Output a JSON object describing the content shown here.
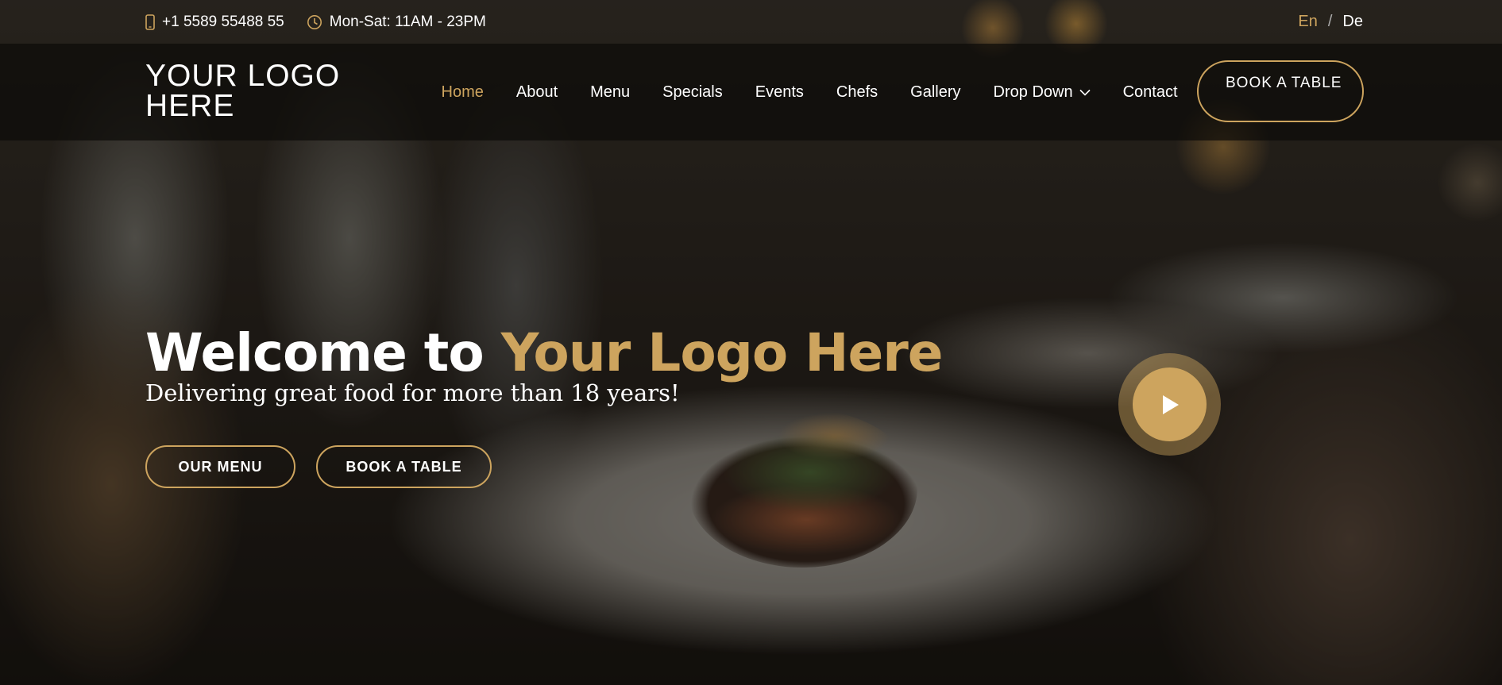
{
  "topbar": {
    "phone": "+1 5589 55488 55",
    "hours": "Mon-Sat: 11AM - 23PM",
    "lang_en": "En",
    "lang_sep": "/",
    "lang_de": "De"
  },
  "header": {
    "logo": "YOUR LOGO HERE",
    "nav": [
      "Home",
      "About",
      "Menu",
      "Specials",
      "Events",
      "Chefs",
      "Gallery",
      "Drop Down",
      "Contact"
    ],
    "active_nav": "Home",
    "book_button": "BOOK A TABLE"
  },
  "hero": {
    "title_prefix": "Welcome to ",
    "title_accent": "Your Logo Here",
    "subtitle": "Delivering great food for more than 18 years!",
    "menu_button": "OUR MENU",
    "book_button": "BOOK A TABLE"
  },
  "colors": {
    "accent": "#cda45e",
    "text": "#ffffff",
    "header_bg": "#0c0b09"
  },
  "icons": {
    "phone": "phone-icon",
    "hours": "clock-icon",
    "dropdown": "chevron-down-icon",
    "play": "play-icon"
  }
}
